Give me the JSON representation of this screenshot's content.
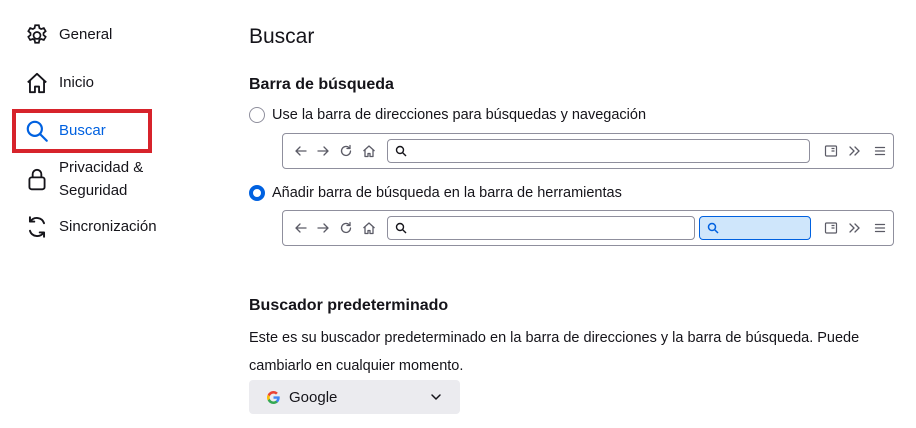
{
  "sidebar": {
    "items": [
      {
        "label": "General",
        "icon": "gear-icon"
      },
      {
        "label": "Inicio",
        "icon": "home-icon"
      },
      {
        "label": "Buscar",
        "icon": "search-icon",
        "selected": true
      },
      {
        "label": "Privacidad &",
        "label_line2": "Seguridad",
        "icon": "lock-icon"
      },
      {
        "label": "Sincronización",
        "icon": "sync-icon"
      }
    ]
  },
  "main": {
    "title": "Buscar",
    "search_bar_section": {
      "heading": "Barra de búsqueda",
      "options": [
        {
          "label": "Use la barra de direcciones para búsquedas y navegación",
          "checked": false
        },
        {
          "label": "Añadir barra de búsqueda en la barra de herramientas",
          "checked": true
        }
      ]
    },
    "default_engine_section": {
      "heading": "Buscador predeterminado",
      "description": "Este es su buscador predeterminado en la barra de direcciones y la barra de búsqueda. Puede cambiarlo en cualquier momento.",
      "selected_engine": "Google",
      "engine_icon": "google-g-icon"
    }
  },
  "colors": {
    "accent": "#0061e0",
    "highlight_box": "#d7232b",
    "select_bg": "#ebebef",
    "search_field_bg": "#cfe6fb"
  }
}
